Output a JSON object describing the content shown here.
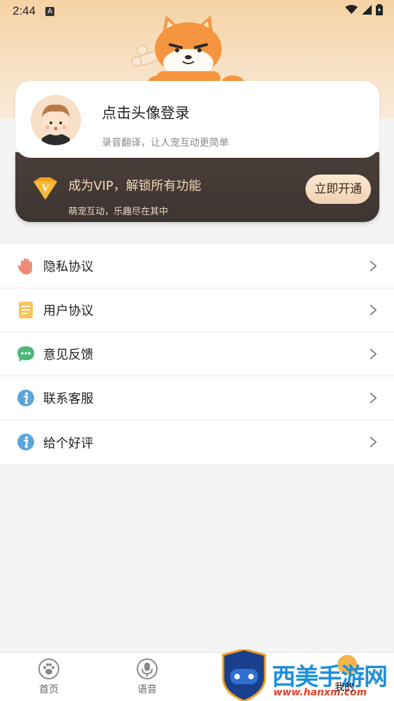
{
  "status_bar": {
    "time": "2:44",
    "a_label": "A"
  },
  "profile": {
    "login_title": "点击头像登录",
    "login_subtitle": "录音翻译，让人宠互动更简单"
  },
  "vip": {
    "title": "成为VIP，解锁所有功能",
    "subtitle": "萌宠互动，乐趣尽在其中",
    "button_label": "立即开通",
    "badge_letter": "V"
  },
  "menu": {
    "items": [
      {
        "label": "隐私协议",
        "icon": "hand-icon"
      },
      {
        "label": "用户协议",
        "icon": "document-icon"
      },
      {
        "label": "意见反馈",
        "icon": "chat-bubble-icon"
      },
      {
        "label": "联系客服",
        "icon": "info-icon"
      },
      {
        "label": "给个好评",
        "icon": "info-icon"
      }
    ]
  },
  "tabs": [
    {
      "label": "首页",
      "icon": "paw-icon"
    },
    {
      "label": "语音",
      "icon": "microphone-icon"
    },
    {
      "label": "我的",
      "icon": "profile-icon"
    }
  ],
  "watermark": {
    "text": "西美手游网",
    "url": "www.hanxm.com"
  },
  "colors": {
    "vip_bg": "#3e3431",
    "vip_text": "#f3d9b8",
    "page_bg": "#f4f4f4",
    "watermark_blue": "#1f8fd8",
    "watermark_red": "#e6402a"
  }
}
